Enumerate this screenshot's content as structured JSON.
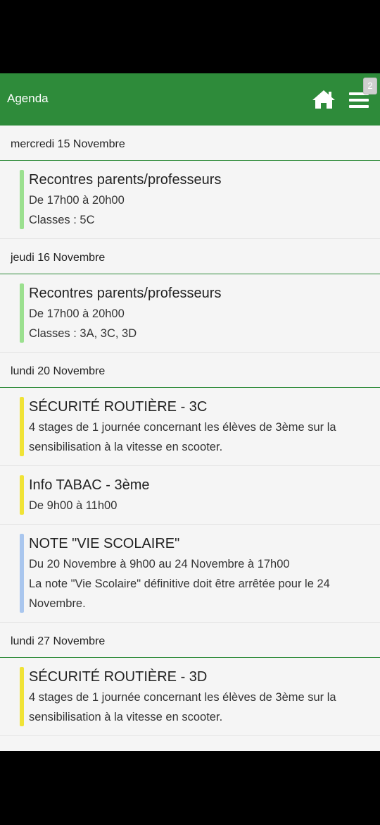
{
  "app": {
    "title": "Agenda",
    "notification_count": "2",
    "colors": {
      "primary": "#2e8b3a",
      "green_bar": "#9be08f",
      "yellow_bar": "#f0e336",
      "blue_bar": "#a9c6ee"
    },
    "icons": [
      "home-icon",
      "menu-icon"
    ]
  },
  "days": [
    {
      "date": "mercredi 15 Novembre",
      "events": [
        {
          "title": "Recontres parents/professeurs",
          "lines": [
            "De 17h00 à 20h00",
            "Classes : 5C"
          ],
          "color": "#9be08f"
        }
      ]
    },
    {
      "date": "jeudi 16 Novembre",
      "events": [
        {
          "title": "Recontres parents/professeurs",
          "lines": [
            "De 17h00 à 20h00",
            "Classes : 3A, 3C, 3D"
          ],
          "color": "#9be08f"
        }
      ]
    },
    {
      "date": "lundi 20 Novembre",
      "events": [
        {
          "title": "SÉCURITÉ ROUTIÈRE - 3C",
          "lines": [
            "4 stages de 1 journée concernant les élèves de 3ème sur la sensibilisation à la vitesse en scooter."
          ],
          "color": "#f0e336"
        },
        {
          "title": "Info TABAC - 3ème",
          "lines": [
            "De 9h00 à 11h00"
          ],
          "color": "#f0e336"
        },
        {
          "title": "NOTE \"VIE SCOLAIRE\"",
          "lines": [
            "Du 20 Novembre à 9h00 au 24 Novembre à 17h00",
            "La note \"Vie Scolaire\" définitive doit être arrêtée pour le 24 Novembre."
          ],
          "color": "#a9c6ee"
        }
      ]
    },
    {
      "date": "lundi 27 Novembre",
      "events": [
        {
          "title": "SÉCURITÉ ROUTIÈRE - 3D",
          "lines": [
            "4 stages de 1 journée concernant les élèves de 3ème sur la sensibilisation à la vitesse en scooter."
          ],
          "color": "#f0e336"
        }
      ]
    }
  ]
}
